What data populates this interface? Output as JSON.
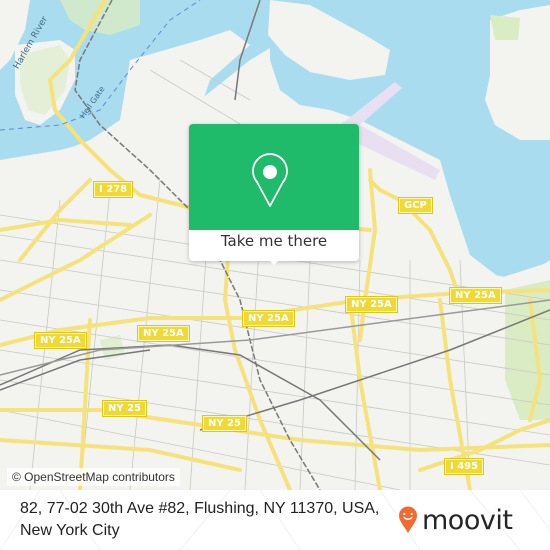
{
  "map": {
    "attribution": "© OpenStreetMap contributors",
    "colors": {
      "land": "#f3f3ef",
      "water": "#a9dcef",
      "park": "#d9ecc4",
      "road_major": "#f6e27a",
      "airport": "#e8e0f0",
      "rail": "#777777",
      "popup_green": "#1fba6a",
      "moovit_orange": "#f26a32"
    },
    "water_labels": {
      "harlem_river": "Harlem River",
      "hell_gate": "Hell Gate"
    },
    "road_shields": {
      "i278": "I 278",
      "gcp": "GCP",
      "ny25a_1": "NY 25A",
      "ny25a_2": "NY 25A",
      "ny25a_3": "NY 25A",
      "ny25a_4": "NY 25A",
      "ny25a_5": "NY 25A",
      "ny25_1": "NY 25",
      "ny25_2": "NY 25",
      "i495": "I 495"
    }
  },
  "popup": {
    "icon": "map-pin-icon",
    "button_label": "Take me there"
  },
  "footer": {
    "address": "82, 77-02 30th Ave #82, Flushing, NY 11370, USA, New York City",
    "brand": "moovit",
    "brand_icon": "moovit-pin-smile-icon"
  }
}
